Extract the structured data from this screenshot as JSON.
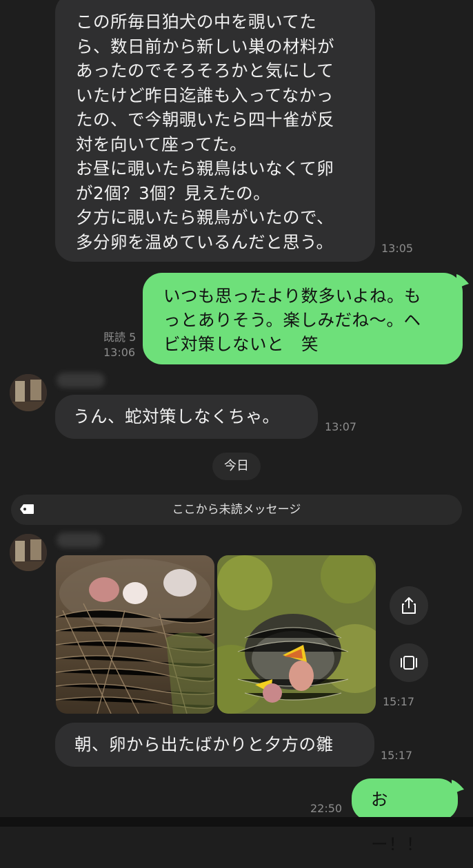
{
  "messages": {
    "m1": {
      "text": "この所毎日狛犬の中を覗いてた\nら、数日前から新しい巣の材料が\nあったのでそろそろかと気にして\nいたけど昨日迄誰も入ってなかっ\nたの、で今朝覗いたら四十雀が反\n対を向いて座ってた。\nお昼に覗いたら親鳥はいなくて卵\nが2個？3個？見えたの。\n夕方に覗いたら親鳥がいたので、\n多分卵を温めているんだと思う。",
      "time": "13:05"
    },
    "m2": {
      "text": "いつも思ったより数多いよね。も\nっとありそう。楽しみだね〜。ヘ\nビ対策しないと　笑",
      "read": "既読 5",
      "time": "13:06"
    },
    "m3": {
      "text": "うん、蛇対策しなくちゃ。",
      "time": "13:07"
    },
    "date_separator": "今日",
    "unread_separator": "ここから未読メッセージ",
    "m4": {
      "time": "15:17",
      "photos": [
        "nest-with-eggs",
        "nest-with-chicks"
      ]
    },
    "m5": {
      "text": "朝、卵から出たばかりと夕方の雛",
      "time": "15:17"
    },
    "m6": {
      "text": "おー！！",
      "time": "22:50"
    }
  },
  "icons": {
    "share": "share-icon",
    "gallery": "gallery-icon",
    "tag": "tag-icon"
  },
  "colors": {
    "background": "#1e1e1e",
    "incoming_bubble": "#2f2f30",
    "outgoing_bubble": "#6ee07a",
    "meta_text": "#8d8d8d"
  }
}
